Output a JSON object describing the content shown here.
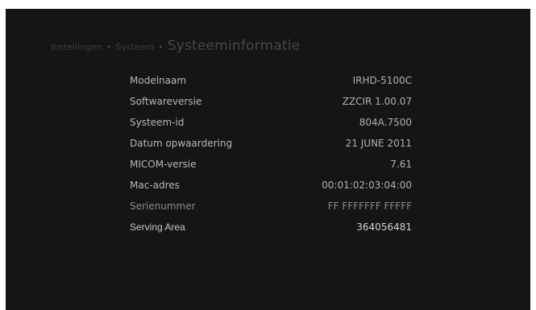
{
  "breadcrumb": {
    "level1": "Instellingen",
    "separator1": "•",
    "level2": "Systeem",
    "separator2": "•",
    "current": "Systeeminformatie"
  },
  "info_rows": [
    {
      "label": "Modelnaam",
      "value": "IRHD-5100C"
    },
    {
      "label": "Softwareversie",
      "value": "ZZCIR 1.00.07"
    },
    {
      "label": "Systeem-id",
      "value": "804A.7500"
    },
    {
      "label": "Datum opwaardering",
      "value": "21 JUNE 2011"
    },
    {
      "label": "MICOM-versie",
      "value": "7.61"
    },
    {
      "label": "Mac-adres",
      "value": "00:01:02:03:04:00"
    },
    {
      "label": "Serienummer",
      "value": "FF FFFFFFF FFFFF"
    },
    {
      "label": "Serving Area",
      "value": "364056481"
    }
  ],
  "colors": {
    "screen_background": "#151515",
    "label_text": "#b7b7b7",
    "breadcrumb_text": "#474747"
  }
}
